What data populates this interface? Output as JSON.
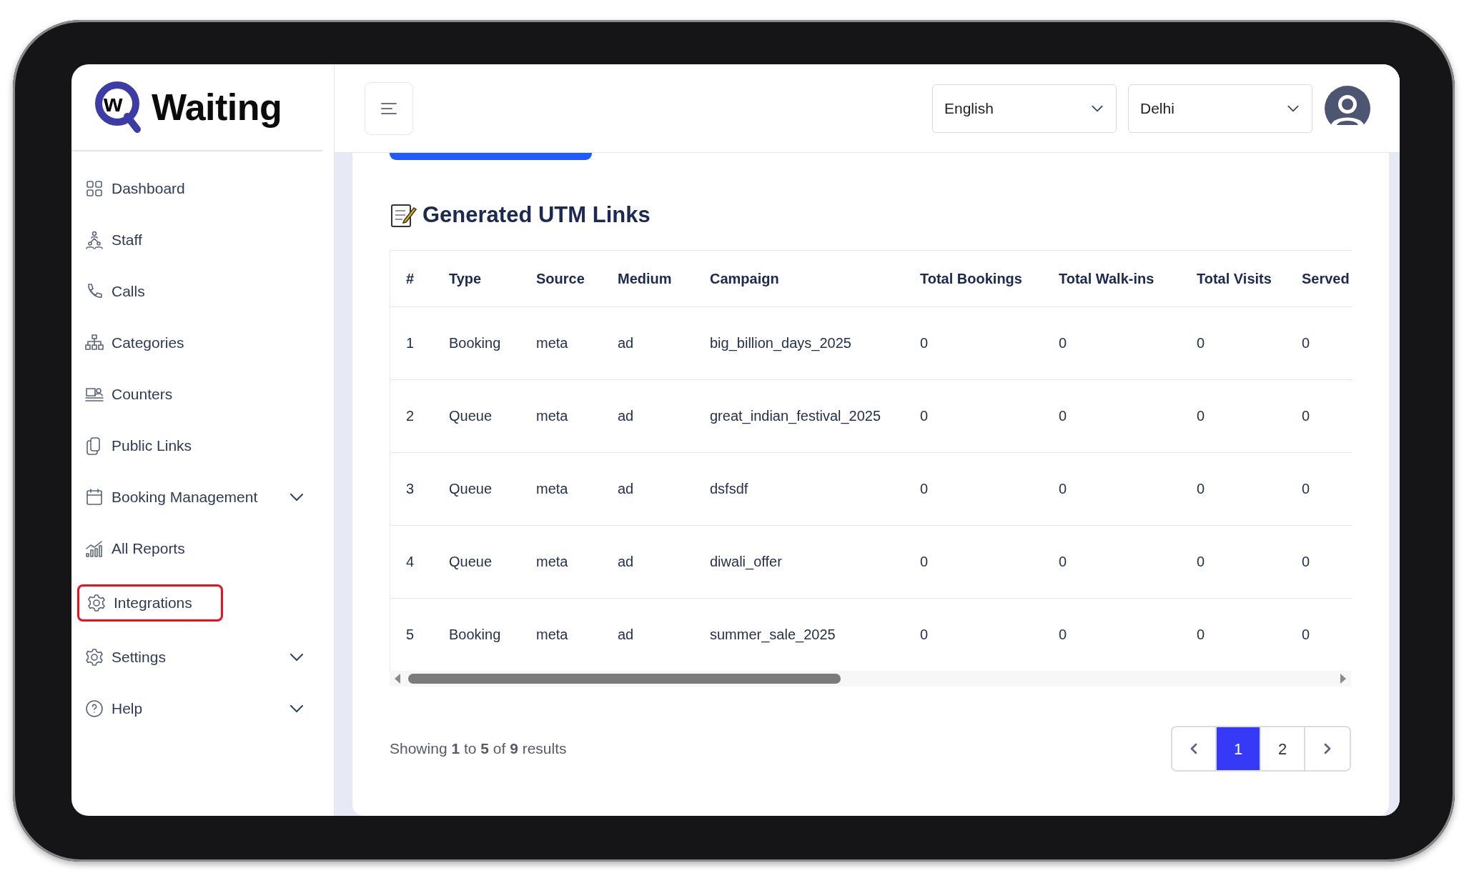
{
  "sidebar": {
    "logo": {
      "mark": "w",
      "text": "Waiting"
    },
    "items": [
      {
        "label": "Dashboard",
        "highlighted": false,
        "has_submenu": false
      },
      {
        "label": "Staff",
        "highlighted": false,
        "has_submenu": false
      },
      {
        "label": "Calls",
        "highlighted": false,
        "has_submenu": false
      },
      {
        "label": "Categories",
        "highlighted": false,
        "has_submenu": false
      },
      {
        "label": "Counters",
        "highlighted": false,
        "has_submenu": false
      },
      {
        "label": "Public Links",
        "highlighted": false,
        "has_submenu": false
      },
      {
        "label": "Booking Management",
        "highlighted": false,
        "has_submenu": true
      },
      {
        "label": "All Reports",
        "highlighted": false,
        "has_submenu": false
      },
      {
        "label": "Integrations",
        "highlighted": true,
        "has_submenu": false
      },
      {
        "label": "Settings",
        "highlighted": false,
        "has_submenu": true
      },
      {
        "label": "Help",
        "highlighted": false,
        "has_submenu": true
      }
    ]
  },
  "topbar": {
    "language": "English",
    "location": "Delhi"
  },
  "card": {
    "title": "Generated UTM Links",
    "table": {
      "columns": [
        "#",
        "Type",
        "Source",
        "Medium",
        "Campaign",
        "Total Bookings",
        "Total Walk-ins",
        "Total Visits",
        "Served"
      ],
      "rows": [
        [
          "1",
          "Booking",
          "meta",
          "ad",
          "big_billion_days_2025",
          "0",
          "0",
          "0",
          "0"
        ],
        [
          "2",
          "Queue",
          "meta",
          "ad",
          "great_indian_festival_2025",
          "0",
          "0",
          "0",
          "0"
        ],
        [
          "3",
          "Queue",
          "meta",
          "ad",
          "dsfsdf",
          "0",
          "0",
          "0",
          "0"
        ],
        [
          "4",
          "Queue",
          "meta",
          "ad",
          "diwali_offer",
          "0",
          "0",
          "0",
          "0"
        ],
        [
          "5",
          "Booking",
          "meta",
          "ad",
          "summer_sale_2025",
          "0",
          "0",
          "0",
          "0"
        ]
      ]
    },
    "summary": "Showing **1** to **5** of **9** results",
    "pagination": [
      {
        "kind": "prev",
        "selected": false
      },
      {
        "kind": "page",
        "label": "1",
        "selected": true
      },
      {
        "kind": "page",
        "label": "2",
        "selected": false
      },
      {
        "kind": "next",
        "selected": false
      }
    ]
  }
}
